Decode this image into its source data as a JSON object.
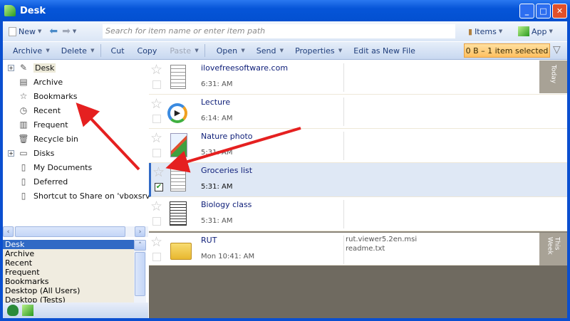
{
  "window": {
    "title": "Desk"
  },
  "toolbar1": {
    "new": "New",
    "search_placeholder": "Search for item name or enter item path",
    "items": "Items",
    "app": "App"
  },
  "toolbar2": {
    "archive": "Archive",
    "delete": "Delete",
    "cut": "Cut",
    "copy": "Copy",
    "paste": "Paste",
    "open": "Open",
    "send": "Send",
    "properties": "Properties",
    "edit_new": "Edit as New File",
    "status": "0 B – 1 item selected"
  },
  "tree": [
    {
      "label": "Desk",
      "icon": "feather-icon",
      "expand": true
    },
    {
      "label": "Archive",
      "icon": "archive-box-icon"
    },
    {
      "label": "Bookmarks",
      "icon": "star-icon"
    },
    {
      "label": "Recent",
      "icon": "clock-icon"
    },
    {
      "label": "Frequent",
      "icon": "bars-icon"
    },
    {
      "label": "Recycle bin",
      "icon": "trash-icon"
    },
    {
      "label": "Disks",
      "icon": "disk-icon",
      "expand": true
    },
    {
      "label": "My Documents",
      "icon": "folder-icon"
    },
    {
      "label": "Deferred",
      "icon": "folder-icon"
    },
    {
      "label": "Shortcut to Share on 'vboxsrv' (E:)",
      "icon": "folder-icon"
    }
  ],
  "desk_list": [
    "Desk",
    "Archive",
    "Recent",
    "Frequent",
    "Bookmarks",
    "Desktop  (All Users)",
    "Desktop  (Tests)"
  ],
  "items": [
    {
      "name": "ilovefreesoftware.com",
      "time": "6:31: AM",
      "icon": "notepad-icon"
    },
    {
      "name": "Lecture",
      "time": "6:14: AM",
      "icon": "media-icon"
    },
    {
      "name": "Nature photo",
      "time": "5:31: AM",
      "icon": "paint-icon"
    },
    {
      "name": "Groceries list",
      "time": "5:31: AM",
      "icon": "notepad-icon",
      "selected": true,
      "checked": true
    },
    {
      "name": "Biology class",
      "time": "5:31: AM",
      "icon": "document-icon"
    },
    {
      "name": "RUT",
      "time": "Mon 10:41: AM",
      "icon": "folder-icon",
      "attachments": [
        "rut.viewer5.2en.msi",
        "readme.txt"
      ]
    }
  ],
  "groups": {
    "today": "Today",
    "this_week": "This Week"
  },
  "colors": {
    "title": "#0655d8",
    "selected": "#316ac5",
    "annotation": "#e52020"
  }
}
